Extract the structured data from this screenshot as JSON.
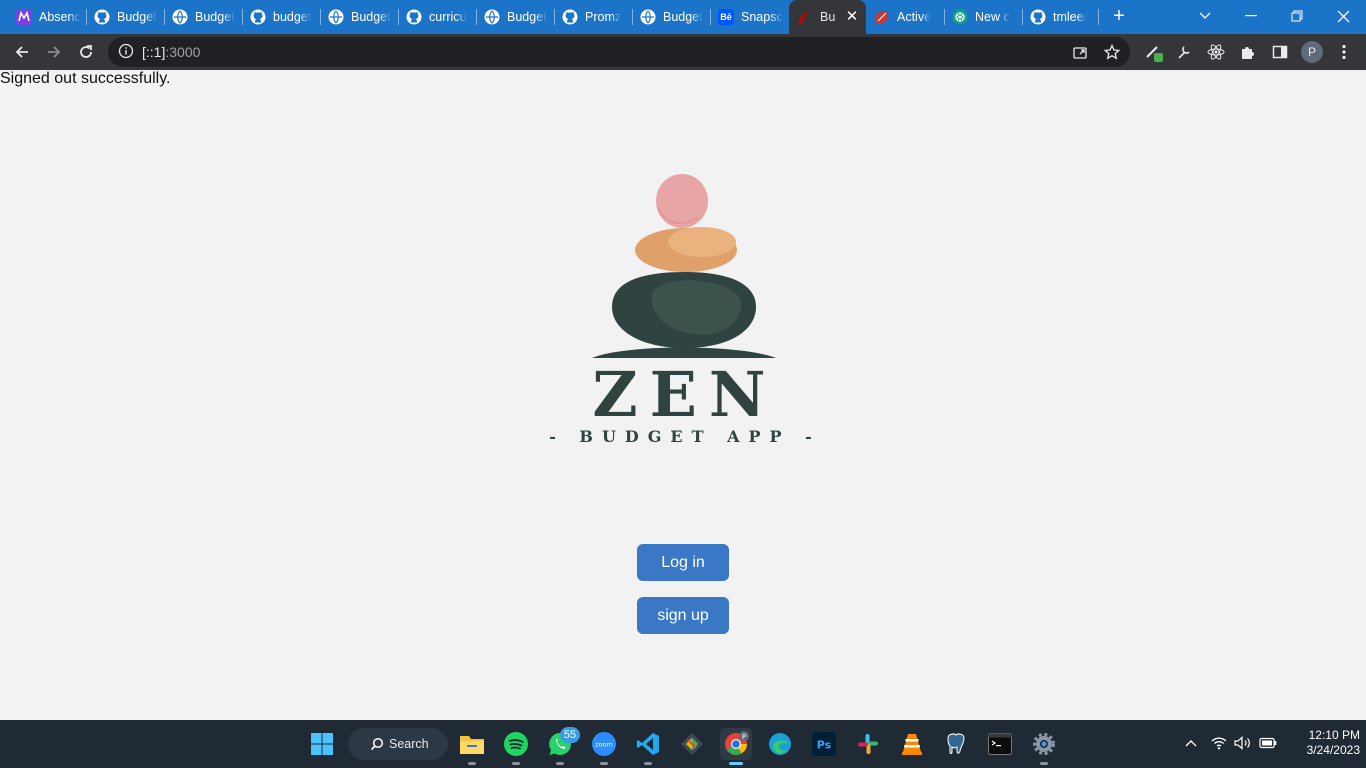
{
  "browser": {
    "tabs": [
      {
        "title": "Absenc",
        "icon": "microverse-icon",
        "color": "#7b3fe4"
      },
      {
        "title": "Budget",
        "icon": "github-icon",
        "color": "#ffffff"
      },
      {
        "title": "Budget",
        "icon": "globe-icon",
        "color": "#ffffff"
      },
      {
        "title": "budget",
        "icon": "github-icon",
        "color": "#ffffff"
      },
      {
        "title": "Budget",
        "icon": "globe-icon",
        "color": "#ffffff"
      },
      {
        "title": "curricu",
        "icon": "github-icon",
        "color": "#ffffff"
      },
      {
        "title": "Budget",
        "icon": "globe-icon",
        "color": "#ffffff"
      },
      {
        "title": "Promz",
        "icon": "github-icon",
        "color": "#ffffff"
      },
      {
        "title": "Budget",
        "icon": "globe-icon",
        "color": "#ffffff"
      },
      {
        "title": "Snapsc",
        "icon": "behance-icon",
        "color": "#0057ff"
      },
      {
        "title": "Bu",
        "icon": "rails-icon",
        "color": "#cc0000",
        "active": true
      },
      {
        "title": "Active",
        "icon": "ruby-icon",
        "color": "#cc342d"
      },
      {
        "title": "New c",
        "icon": "openai-icon",
        "color": "#10a37f"
      },
      {
        "title": "tmlee/",
        "icon": "github-icon",
        "color": "#ffffff"
      }
    ],
    "address": {
      "host": "[::1]",
      "port": ":3000"
    },
    "profile_initial": "P"
  },
  "page": {
    "flash": "Signed out successfully.",
    "logo": {
      "title": "ZEN",
      "subtitle": "- BUDGET APP -"
    },
    "login_label": "Log in",
    "signup_label": "sign up"
  },
  "taskbar": {
    "search_label": "Search",
    "whatsapp_badge": "55",
    "time": "12:10 PM",
    "date": "3/24/2023",
    "chrome_badge": "P"
  },
  "colors": {
    "tabstrip": "#1b74c8",
    "toolbar": "#35363a",
    "page_bg": "#f2f2f2",
    "button": "#3a78c6",
    "logo_dark": "#2f4440",
    "stone_pink": "#e8a5a5",
    "stone_orange": "#e0a06a"
  }
}
